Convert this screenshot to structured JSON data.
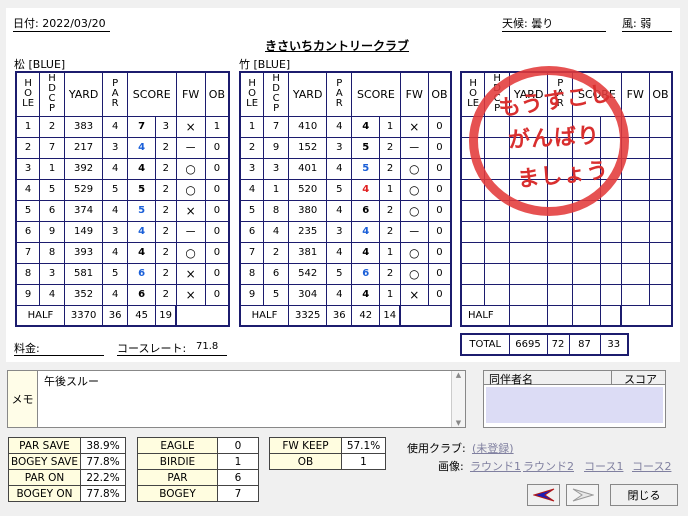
{
  "header": {
    "date_label": "日付: 2022/03/20",
    "weather_label": "天候: 曇り",
    "wind_label": "風: 弱"
  },
  "club_name": "きさいちカントリークラブ",
  "course1": {
    "name": "松 [BLUE]"
  },
  "course2": {
    "name": "竹 [BLUE]"
  },
  "col_headers": {
    "hole": "HOLE",
    "hdcp": "HDCP",
    "yard": "YARD",
    "par": "PAR",
    "score": "SCORE",
    "fw": "FW",
    "ob": "OB"
  },
  "course1_rows": [
    {
      "hole": "1",
      "hdcp": "2",
      "yard": "383",
      "par": "4",
      "score": "7",
      "putt": "3",
      "fw": "×",
      "ob": "1",
      "color": "dark"
    },
    {
      "hole": "2",
      "hdcp": "7",
      "yard": "217",
      "par": "3",
      "score": "4",
      "putt": "2",
      "fw": "－",
      "ob": "0",
      "color": "blue"
    },
    {
      "hole": "3",
      "hdcp": "1",
      "yard": "392",
      "par": "4",
      "score": "4",
      "putt": "2",
      "fw": "○",
      "ob": "0",
      "color": "green"
    },
    {
      "hole": "4",
      "hdcp": "5",
      "yard": "529",
      "par": "5",
      "score": "5",
      "putt": "2",
      "fw": "○",
      "ob": "0",
      "color": "green"
    },
    {
      "hole": "5",
      "hdcp": "6",
      "yard": "374",
      "par": "4",
      "score": "5",
      "putt": "2",
      "fw": "×",
      "ob": "0",
      "color": "blue"
    },
    {
      "hole": "6",
      "hdcp": "9",
      "yard": "149",
      "par": "3",
      "score": "4",
      "putt": "2",
      "fw": "－",
      "ob": "0",
      "color": "blue"
    },
    {
      "hole": "7",
      "hdcp": "8",
      "yard": "393",
      "par": "4",
      "score": "4",
      "putt": "2",
      "fw": "○",
      "ob": "0",
      "color": "green"
    },
    {
      "hole": "8",
      "hdcp": "3",
      "yard": "581",
      "par": "5",
      "score": "6",
      "putt": "2",
      "fw": "×",
      "ob": "0",
      "color": "blue"
    },
    {
      "hole": "9",
      "hdcp": "4",
      "yard": "352",
      "par": "4",
      "score": "6",
      "putt": "2",
      "fw": "×",
      "ob": "0",
      "color": "dark"
    }
  ],
  "course1_half": {
    "label": "HALF",
    "yard": "3370",
    "par": "36",
    "score": "45",
    "putt": "19"
  },
  "course2_rows": [
    {
      "hole": "1",
      "hdcp": "7",
      "yard": "410",
      "par": "4",
      "score": "4",
      "putt": "1",
      "fw": "×",
      "ob": "0",
      "color": "green"
    },
    {
      "hole": "2",
      "hdcp": "9",
      "yard": "152",
      "par": "3",
      "score": "5",
      "putt": "2",
      "fw": "－",
      "ob": "0",
      "color": "dark"
    },
    {
      "hole": "3",
      "hdcp": "3",
      "yard": "401",
      "par": "4",
      "score": "5",
      "putt": "2",
      "fw": "○",
      "ob": "0",
      "color": "blue"
    },
    {
      "hole": "4",
      "hdcp": "1",
      "yard": "520",
      "par": "5",
      "score": "4",
      "putt": "1",
      "fw": "○",
      "ob": "0",
      "color": "red"
    },
    {
      "hole": "5",
      "hdcp": "8",
      "yard": "380",
      "par": "4",
      "score": "6",
      "putt": "2",
      "fw": "○",
      "ob": "0",
      "color": "dark"
    },
    {
      "hole": "6",
      "hdcp": "4",
      "yard": "235",
      "par": "3",
      "score": "4",
      "putt": "2",
      "fw": "－",
      "ob": "0",
      "color": "blue"
    },
    {
      "hole": "7",
      "hdcp": "2",
      "yard": "381",
      "par": "4",
      "score": "4",
      "putt": "1",
      "fw": "○",
      "ob": "0",
      "color": "green"
    },
    {
      "hole": "8",
      "hdcp": "6",
      "yard": "542",
      "par": "5",
      "score": "6",
      "putt": "2",
      "fw": "○",
      "ob": "0",
      "color": "blue"
    },
    {
      "hole": "9",
      "hdcp": "5",
      "yard": "304",
      "par": "4",
      "score": "4",
      "putt": "1",
      "fw": "×",
      "ob": "0",
      "color": "green"
    }
  ],
  "course2_half": {
    "label": "HALF",
    "yard": "3325",
    "par": "36",
    "score": "42",
    "putt": "14"
  },
  "course3_half": {
    "label": "HALF"
  },
  "total": {
    "label": "TOTAL",
    "yard": "6695",
    "par": "72",
    "score": "87",
    "putt": "33"
  },
  "stamp": {
    "line1": "もうすこし",
    "line2": "がんばり",
    "line3": "ましょう"
  },
  "fee_label": "料金:",
  "course_rate": {
    "label": "コースレート:",
    "value": "71.8"
  },
  "memo": {
    "label": "メモ",
    "text": "午後スルー"
  },
  "companions": {
    "name_header": "同伴者名",
    "score_header": "スコア"
  },
  "stats": {
    "par_save": {
      "label": "PAR SAVE",
      "value": "38.9%"
    },
    "bogey_save": {
      "label": "BOGEY SAVE",
      "value": "77.8%"
    },
    "par_on": {
      "label": "PAR ON",
      "value": "22.2%"
    },
    "bogey_on": {
      "label": "BOGEY ON",
      "value": "77.8%"
    },
    "eagle": {
      "label": "EAGLE",
      "value": "0"
    },
    "birdie": {
      "label": "BIRDIE",
      "value": "1"
    },
    "par": {
      "label": "PAR",
      "value": "6"
    },
    "bogey": {
      "label": "BOGEY",
      "value": "7"
    },
    "fw_keep": {
      "label": "FW KEEP",
      "value": "57.1%"
    },
    "ob": {
      "label": "OB",
      "value": "1"
    }
  },
  "clubs": {
    "label": "使用クラブ:",
    "value": "(未登録)"
  },
  "images": {
    "label": "画像:",
    "round1": "ラウンド1",
    "round2": "ラウンド2",
    "course1": "コース1",
    "course2": "コース2"
  },
  "buttons": {
    "close": "閉じる"
  },
  "colors": {
    "blue": "#1a5fd8",
    "red": "#e02020",
    "green": "#000000",
    "grid": "#1c1c6e",
    "stamp": "#e23a3a"
  }
}
